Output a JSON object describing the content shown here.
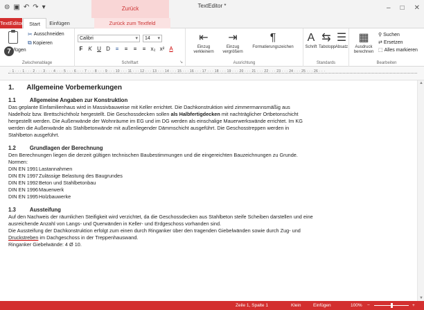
{
  "titlebar": {
    "title": "TextEditor *",
    "context_group": "Zurück",
    "quick_access": [
      "save-icon",
      "disk-icon",
      "undo-icon",
      "redo-icon",
      "customize-icon"
    ],
    "controls": {
      "minimize": "–",
      "maximize": "□",
      "close": "✕"
    }
  },
  "tabs": {
    "app": "TextEditor",
    "start": "Start",
    "insert": "Einfügen",
    "back_to_text": "Zurück zum Textfeld"
  },
  "ribbon": {
    "clipboard": {
      "label": "Zwischenablage",
      "paste": "Einfügen",
      "cut": "Ausschneiden",
      "copy": "Kopieren"
    },
    "font": {
      "label": "Schriftart",
      "family": "Calibri",
      "size": "14",
      "buttons": [
        "F",
        "K",
        "U",
        "D",
        "≡",
        "≡",
        "≡",
        "≡",
        "x₂",
        "x²",
        "A"
      ]
    },
    "paragraph": {
      "label": "Ausrichtung",
      "decrease_indent": "Einzug verkleinern",
      "increase_indent": "Einzug vergrößern",
      "formatting_marks": "Formatierungszeichen"
    },
    "styles": {
      "label": "Standards",
      "font": "Schrift",
      "tab_stop": "Tabstopp",
      "paragraph": "Absatz"
    },
    "edit": {
      "label": "Bearbeiten",
      "calc": "Ausdruck berechnen",
      "search": "Suchen",
      "replace": "Ersetzen",
      "select_all": "Alles markieren"
    }
  },
  "callout": "7",
  "ruler": "· 1 · · · 1 · · · 2 · · · 3 · · · 4 · · · 5 · · · 6 · · · 7 · · · 8 · · · 9 · · · 10 · · · 11 · · · 12 · · · 13 · · · 14 · · · 15 · · · 16 · · · 17 · · · 18 · · · 19 · · · 20 · · · 21 · · · 22 · · · 23 · · · 24 · · · 25 · · · 26 · · ·",
  "document": {
    "h1_num": "1.",
    "h1_text": "Allgemeine Vorbemerkungen",
    "s1_num": "1.1",
    "s1_title": "Allgemeine Angaben zur Konstruktion",
    "s1_l1": "Das geplante Einfamilienhaus wird in Massivbauweise mit Keller errichtet. Die Dachkonstruktion wird zimmermannsmäßig aus",
    "s1_l2a": "Nadelholz bzw. Brettschichtholz hergestellt. Die Geschossdecken sollen ",
    "s1_l2b": "als Halbfertigdecken",
    "s1_l2c": " mit nachträglicher Ortbetonschicht",
    "s1_l3": "hergestellt werden. Die Außenwände der Wohnräume im EG und im DG werden als einschalige Mauerwerkswände errichtet. Im KG",
    "s1_l4": "werden die Außenwände als Stahlbetonwände mit außenliegender Dämmschicht ausgeführt. Die Geschosstreppen werden in",
    "s1_l5": "Stahlbeton ausgeführt.",
    "s2_num": "1.2",
    "s2_title": "Grundlagen der Berechnung",
    "s2_l1": "Den Berechnungen liegen die derzeit gültigen technischen Baubestimmungen und die eingereichten Bauzeichnungen zu Grunde.",
    "s2_l2": "Normen:",
    "norms": [
      {
        "code": "DIN EN 1991",
        "desc": "Lastannahmen"
      },
      {
        "code": "DIN EN 1997",
        "desc": "Zulässige Belastung des Baugrundes"
      },
      {
        "code": "DIN EN 1992",
        "desc": "Beton und Stahlbetonbau"
      },
      {
        "code": "DIN EN 1996",
        "desc": "Mauerwerk"
      },
      {
        "code": "DIN EN 1995",
        "desc": "Holzbauwerke"
      }
    ],
    "s3_num": "1.3",
    "s3_title": "Aussteifung",
    "s3_l1": "Auf den Nachweis der räumlichen Steifigkeit wird verzichtet, da die Geschossdecken aus Stahlbeton steife Scheiben darstellen und eine",
    "s3_l2": "ausreichende Anzahl von Langs- und Querwänden in Keller- und Erdgeschoss vorhanden sind.",
    "s3_l3": "Die Aussteifung der Dachkonstruktion erfolgt zum einen durch Ringanker über den tragenden Giebelwänden sowie durch Zug- und",
    "s3_l4a": "Druckstreben",
    "s3_l4b": " im Dachgeschoss in der Treppenhauswand.",
    "s3_l5": "Ringanker Giebelwände: 4 Ø 10."
  },
  "status": {
    "position": "Zeile 1, Spalte 1",
    "mode1": "Klein",
    "mode2": "Einfügen",
    "zoom": "100%",
    "zoom_level": 0.5
  },
  "colors": {
    "accent": "#d32f2f",
    "context_tint": "#f9d6d6"
  }
}
